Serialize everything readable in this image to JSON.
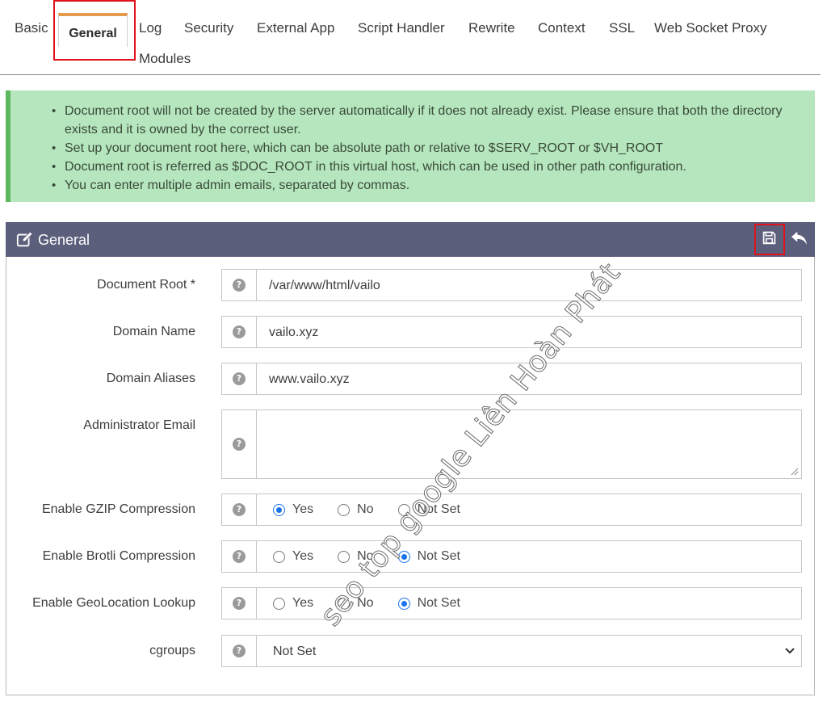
{
  "tabs": [
    {
      "label": "Basic"
    },
    {
      "label": "General",
      "active": true
    },
    {
      "label": "Log"
    },
    {
      "label": "Security"
    },
    {
      "label": "External App"
    },
    {
      "label": "Script Handler"
    },
    {
      "label": "Rewrite"
    },
    {
      "label": "Context"
    },
    {
      "label": "SSL"
    },
    {
      "label": "Web Socket Proxy"
    },
    {
      "label": "Modules"
    }
  ],
  "info": {
    "items": [
      "Document root will not be created by the server automatically if it does not already exist. Please ensure that both the directory exists and it is owned by the correct user.",
      "Set up your document root here, which can be absolute path or relative to $SERV_ROOT or $VH_ROOT",
      "Document root is referred as $DOC_ROOT in this virtual host, which can be used in other path configuration.",
      "You can enter multiple admin emails, separated by commas."
    ],
    "colors": {
      "background": "#b5e6bd",
      "accent": "#5cb85c"
    }
  },
  "panel": {
    "title": "General",
    "icons": {
      "edit": "edit-icon",
      "save": "save-icon",
      "undo": "undo-icon"
    },
    "header_color": "#5c5f7c",
    "help_glyph": "?",
    "fields": {
      "document_root": {
        "label": "Document Root *",
        "value": "/var/www/html/vailo"
      },
      "domain_name": {
        "label": "Domain Name",
        "value": "vailo.xyz"
      },
      "domain_aliases": {
        "label": "Domain Aliases",
        "value": "www.vailo.xyz"
      },
      "admin_email": {
        "label": "Administrator Email",
        "value": ""
      },
      "gzip": {
        "label": "Enable GZIP Compression",
        "options": [
          "Yes",
          "No",
          "Not Set"
        ],
        "selected": "Yes"
      },
      "brotli": {
        "label": "Enable Brotli Compression",
        "options": [
          "Yes",
          "No",
          "Not Set"
        ],
        "selected": "Not Set"
      },
      "geolocation": {
        "label": "Enable GeoLocation Lookup",
        "options": [
          "Yes",
          "No",
          "Not Set"
        ],
        "selected": "Not Set"
      },
      "cgroups": {
        "label": "cgroups",
        "selected": "Not Set"
      }
    }
  },
  "watermark": "seo top google Liên Hoàn Phát",
  "highlight_color": "#e0121b"
}
